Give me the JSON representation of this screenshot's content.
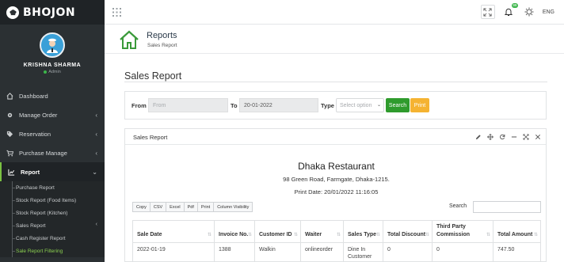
{
  "app": {
    "brand": "BHOJON"
  },
  "user": {
    "name": "KRISHNA SHARMA",
    "role": "Admin"
  },
  "sidebar": {
    "items": [
      {
        "label": "Dashboard",
        "icon": "home-icon"
      },
      {
        "label": "Manage Order",
        "icon": "gear-icon"
      },
      {
        "label": "Reservation",
        "icon": "tag-icon"
      },
      {
        "label": "Purchase Manage",
        "icon": "cart-icon"
      },
      {
        "label": "Report",
        "icon": "chart-icon"
      }
    ],
    "report_sub": [
      {
        "label": "Purchase Report"
      },
      {
        "label": "Stock Report (Food Items)"
      },
      {
        "label": "Stock Report (Kitchen)"
      },
      {
        "label": "Sales Report"
      },
      {
        "label": "Cash Register Report"
      },
      {
        "label": "Sale Report Filtering"
      }
    ]
  },
  "topbar": {
    "notifications": "99",
    "language": "ENG"
  },
  "page_header": {
    "title": "Reports",
    "subtitle": "Sales Report"
  },
  "section": {
    "title": "Sales Report"
  },
  "filter": {
    "from_label": "From",
    "from_placeholder": "From",
    "to_label": "To",
    "to_value": "20-01-2022",
    "type_label": "Type",
    "type_placeholder": "Select option",
    "search_label": "Search",
    "print_label": "Print"
  },
  "card": {
    "title": "Sales Report",
    "restaurant_name": "Dhaka Restaurant",
    "address": "98 Green Road, Farmgate, Dhaka-1215.",
    "print_date": "Print Date: 20/01/2022 11:16:05",
    "export_buttons": [
      "Copy",
      "CSV",
      "Excel",
      "Pdf",
      "Print",
      "Column Visibility"
    ],
    "search_label": "Search"
  },
  "table": {
    "headers": [
      "Sale Date",
      "Invoice No.",
      "Customer ID",
      "Waiter",
      "Sales Type",
      "Total Discount",
      "Third Party Commission",
      "Total Amount"
    ],
    "rows": [
      [
        "2022-01-19",
        "1388",
        "Walkin",
        "onlineorder",
        "Dine In Customer",
        "0",
        "0",
        "747.50"
      ]
    ]
  }
}
